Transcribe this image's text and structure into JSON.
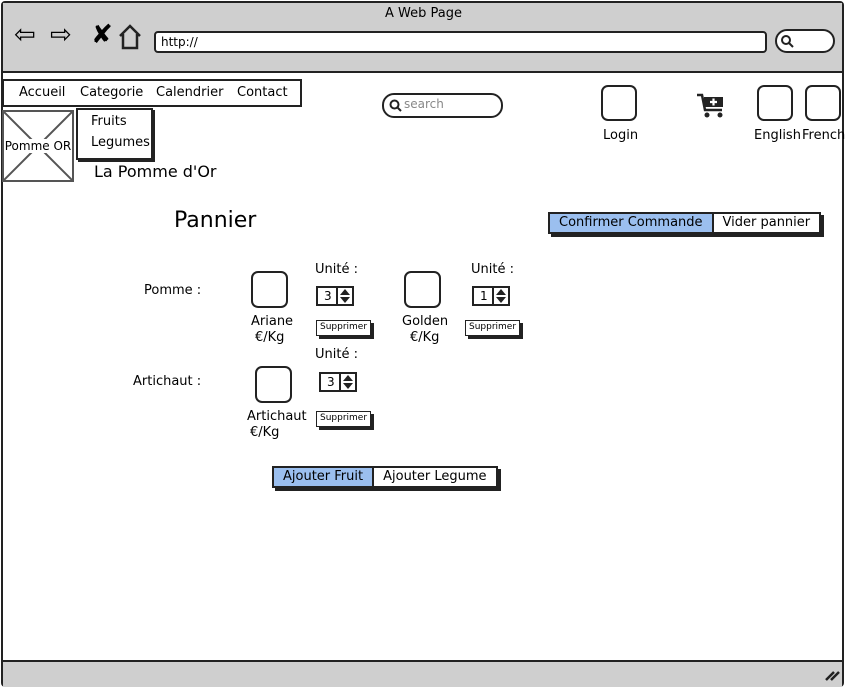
{
  "browser": {
    "title": "A Web Page",
    "url": "http://"
  },
  "menu": {
    "items": [
      "Accueil",
      "Categorie",
      "Calendrier",
      "Contact"
    ],
    "submenu": [
      "Fruits",
      "Legumes"
    ]
  },
  "logo": {
    "label": "Pomme OR",
    "site_name": "La Pomme d'Or"
  },
  "search": {
    "placeholder": "search"
  },
  "header_right": {
    "login": "Login",
    "english": "English",
    "french": "French"
  },
  "page": {
    "title": "Pannier",
    "confirm_label": "Confirmer Commande",
    "clear_label": "Vider pannier",
    "add_fruit_label": "Ajouter Fruit",
    "add_vegetable_label": "Ajouter Legume"
  },
  "cart": {
    "unit_label": "Unité :",
    "remove_label": "Supprimer",
    "categories": [
      {
        "name": "Pomme :",
        "items": [
          {
            "name": "Ariane",
            "price": "€/Kg",
            "quantity": "3"
          },
          {
            "name": "Golden",
            "price": "€/Kg",
            "quantity": "1"
          }
        ]
      },
      {
        "name": "Artichaut :",
        "items": [
          {
            "name": "Artichaut",
            "price": "€/Kg",
            "quantity": "3"
          }
        ]
      }
    ]
  }
}
